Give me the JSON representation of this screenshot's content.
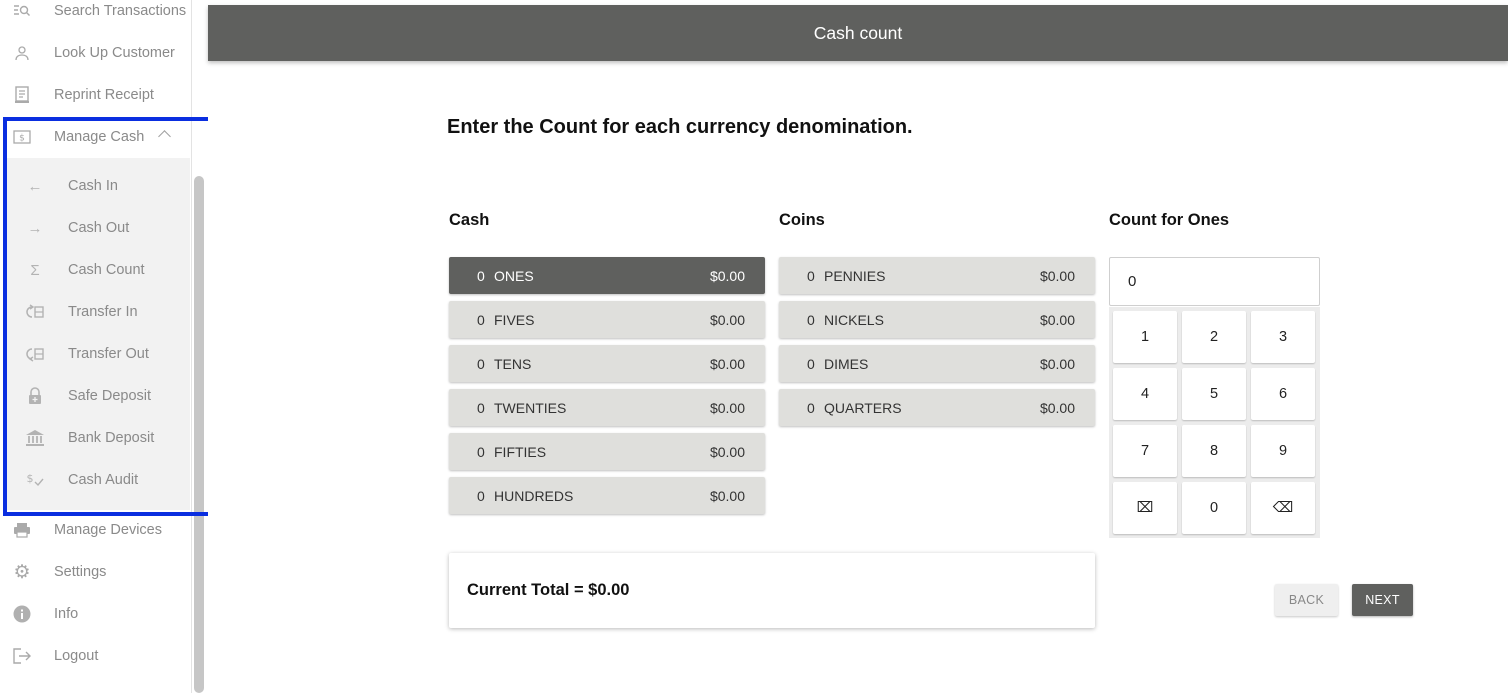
{
  "sidebar": {
    "top_items": [
      {
        "label": "Search Transactions",
        "icon": "search-list-icon"
      },
      {
        "label": "Look Up Customer",
        "icon": "person-icon"
      },
      {
        "label": "Reprint Receipt",
        "icon": "receipt-icon"
      },
      {
        "label": "Manage Cash",
        "icon": "cash-icon"
      }
    ],
    "manage_cash_items": [
      {
        "label": "Cash In",
        "icon": "arrow-left-icon"
      },
      {
        "label": "Cash Out",
        "icon": "arrow-right-icon"
      },
      {
        "label": "Cash Count",
        "icon": "sigma-icon"
      },
      {
        "label": "Transfer In",
        "icon": "transfer-in-icon"
      },
      {
        "label": "Transfer Out",
        "icon": "transfer-out-icon"
      },
      {
        "label": "Safe Deposit",
        "icon": "lock-icon"
      },
      {
        "label": "Bank Deposit",
        "icon": "bank-icon"
      },
      {
        "label": "Cash Audit",
        "icon": "dollar-check-icon"
      }
    ],
    "bottom_items": [
      {
        "label": "Manage Devices",
        "icon": "printer-icon"
      },
      {
        "label": "Settings",
        "icon": "gear-icon"
      },
      {
        "label": "Info",
        "icon": "info-icon"
      },
      {
        "label": "Logout",
        "icon": "logout-icon"
      }
    ]
  },
  "header": {
    "title": "Cash count"
  },
  "main": {
    "instruction": "Enter the Count for each currency denomination.",
    "cash_title": "Cash",
    "coins_title": "Coins",
    "count_title": "Count for Ones",
    "cash": [
      {
        "count": "0",
        "name": "ONES",
        "amount": "$0.00",
        "selected": true
      },
      {
        "count": "0",
        "name": "FIVES",
        "amount": "$0.00"
      },
      {
        "count": "0",
        "name": "TENS",
        "amount": "$0.00"
      },
      {
        "count": "0",
        "name": "TWENTIES",
        "amount": "$0.00"
      },
      {
        "count": "0",
        "name": "FIFTIES",
        "amount": "$0.00"
      },
      {
        "count": "0",
        "name": "HUNDREDS",
        "amount": "$0.00"
      }
    ],
    "coins": [
      {
        "count": "0",
        "name": "PENNIES",
        "amount": "$0.00"
      },
      {
        "count": "0",
        "name": "NICKELS",
        "amount": "$0.00"
      },
      {
        "count": "0",
        "name": "DIMES",
        "amount": "$0.00"
      },
      {
        "count": "0",
        "name": "QUARTERS",
        "amount": "$0.00"
      }
    ],
    "count_value": "0",
    "keypad": [
      "1",
      "2",
      "3",
      "4",
      "5",
      "6",
      "7",
      "8",
      "9",
      "⌧",
      "0",
      "⌫"
    ],
    "total": "Current Total = $0.00",
    "back_label": "BACK",
    "next_label": "NEXT"
  },
  "colors": {
    "header": "#5f605e",
    "highlight_border": "#0a2ee0",
    "tile": "#dfdfdc"
  }
}
